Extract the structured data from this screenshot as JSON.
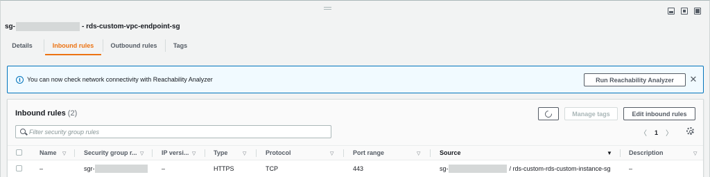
{
  "header": {
    "sg_prefix": "sg-",
    "sg_name": "- rds-custom-vpc-endpoint-sg"
  },
  "tabs": [
    {
      "label": "Details",
      "active": false
    },
    {
      "label": "Inbound rules",
      "active": true
    },
    {
      "label": "Outbound rules",
      "active": false
    },
    {
      "label": "Tags",
      "active": false
    }
  ],
  "banner": {
    "icon": "info-icon",
    "message": "You can now check network connectivity with Reachability Analyzer",
    "button_label": "Run Reachability Analyzer"
  },
  "panel": {
    "title": "Inbound rules",
    "count": "(2)",
    "manage_tags_label": "Manage tags",
    "edit_label": "Edit inbound rules",
    "search_placeholder": "Filter security group rules",
    "page": "1"
  },
  "columns": [
    {
      "label": "Name"
    },
    {
      "label": "Security group r..."
    },
    {
      "label": "IP versi..."
    },
    {
      "label": "Type"
    },
    {
      "label": "Protocol"
    },
    {
      "label": "Port range"
    },
    {
      "label": "Source"
    },
    {
      "label": "Description"
    }
  ],
  "rows": [
    {
      "name": "–",
      "sg_rule_prefix": "sgr-",
      "ip_version": "–",
      "type": "HTTPS",
      "protocol": "TCP",
      "port_range": "443",
      "source_prefix": "sg-",
      "source_suffix": "/ rds-custom-rds-custom-instance-sg",
      "description": "–"
    }
  ],
  "colors": {
    "accent": "#ec7211",
    "info": "#0073bb",
    "info_bg": "#f1faff"
  }
}
